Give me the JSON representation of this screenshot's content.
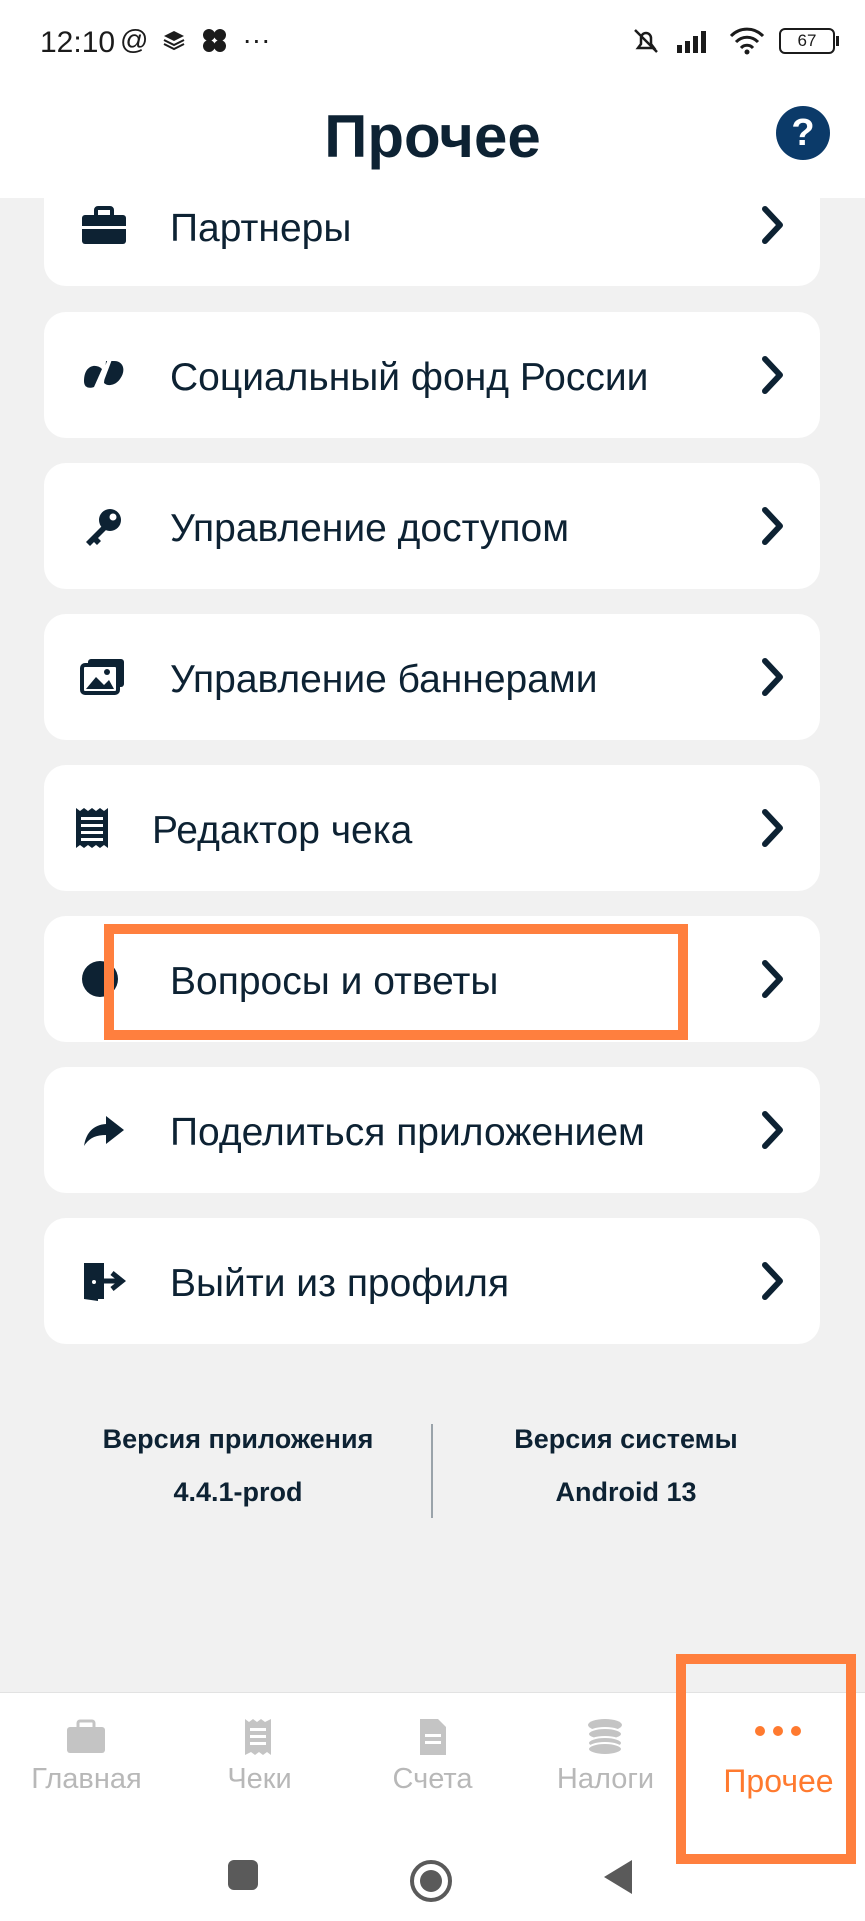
{
  "status_bar": {
    "time": "12:10",
    "left_icons": [
      "at-icon",
      "layers-icon",
      "clover-icon",
      "more-icon"
    ],
    "battery": "67"
  },
  "header": {
    "title": "Прочее",
    "help_icon": "?"
  },
  "menu": {
    "items": [
      {
        "label": "Партнеры",
        "icon": "briefcase-icon"
      },
      {
        "label": "Социальный фонд России",
        "icon": "sfr-logo-icon"
      },
      {
        "label": "Управление доступом",
        "icon": "key-icon"
      },
      {
        "label": "Управление баннерами",
        "icon": "image-icon"
      },
      {
        "label": "Редактор чека",
        "icon": "receipt-icon"
      },
      {
        "label": "Вопросы и ответы",
        "icon": "info-icon"
      },
      {
        "label": "Поделиться приложением",
        "icon": "share-icon"
      },
      {
        "label": "Выйти из профиля",
        "icon": "logout-icon"
      }
    ]
  },
  "versions": {
    "app_caption": "Версия приложения",
    "app_value": "4.4.1-prod",
    "system_caption": "Версия системы",
    "system_value": "Android 13"
  },
  "bottom_nav": {
    "items": [
      {
        "label": "Главная",
        "icon": "briefcase-icon"
      },
      {
        "label": "Чеки",
        "icon": "receipt-icon"
      },
      {
        "label": "Счета",
        "icon": "document-icon"
      },
      {
        "label": "Налоги",
        "icon": "coins-icon"
      },
      {
        "label": "Прочее",
        "icon": "dots-icon"
      }
    ],
    "active": "Прочее"
  },
  "colors": {
    "accent": "#ff7a2f",
    "highlight": "#ff7f3e",
    "text": "#0d2233",
    "help": "#0b3a69"
  }
}
